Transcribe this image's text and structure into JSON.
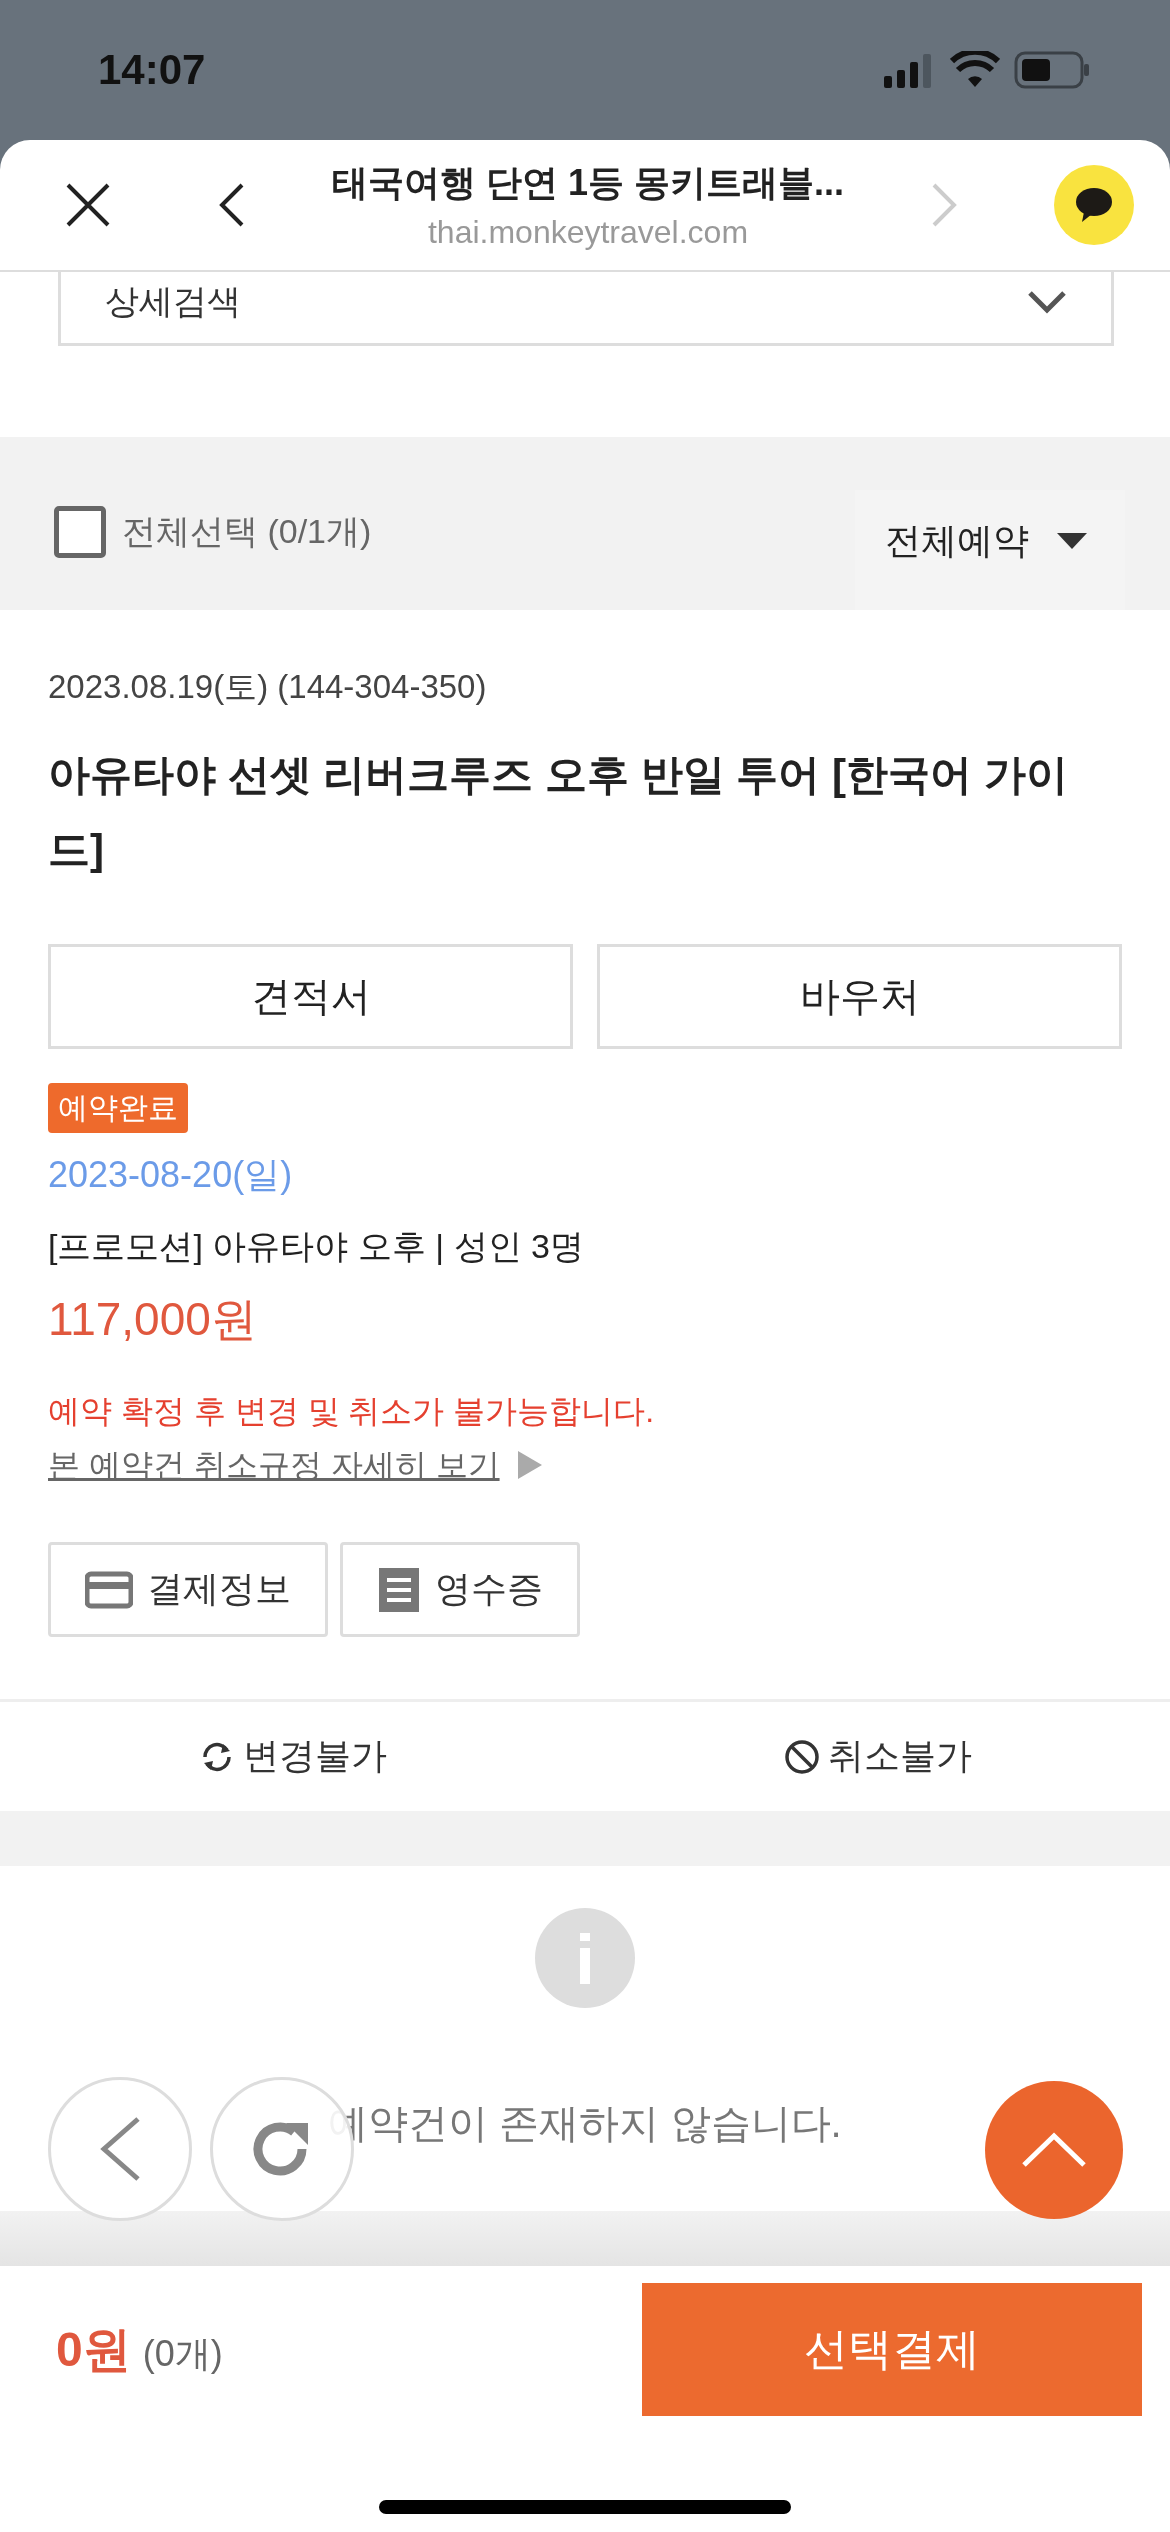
{
  "status_bar": {
    "time": "14:07"
  },
  "browser_header": {
    "title": "태국여행 단연 1등 몽키트래블...",
    "url": "thai.monkeytravel.com"
  },
  "filter": {
    "detail_search": "상세검색"
  },
  "selection_bar": {
    "select_all": {
      "label": "전체선택 (0/1개)",
      "checked": false
    },
    "dropdown": "전체예약"
  },
  "booking": {
    "date_code": "2023.08.19(토) (144-304-350)",
    "title": "아유타야 선셋 리버크루즈 오후 반일 투어 [한국어 가이드]",
    "documents": [
      "견적서",
      "바우처"
    ],
    "status_badge": "예약완료",
    "travel_date": "2023-08-20(일)",
    "description": "[프로모션] 아유타야 오후 | 성인 3명",
    "price": "117,000원",
    "warning": "예약 확정 후 변경 및 취소가 불가능합니다.",
    "policy_link": "본 예약건 취소규정 자세히 보기",
    "info_buttons": [
      {
        "label": "결제정보",
        "kind": "card"
      },
      {
        "label": "영수증",
        "kind": "receipt"
      }
    ],
    "actions": [
      {
        "label": "변경불가",
        "kind": "change"
      },
      {
        "label": "취소불가",
        "kind": "cancel"
      }
    ]
  },
  "empty_state": {
    "message": "예약건이 존재하지 않습니다."
  },
  "bottom_bar": {
    "total": "0원",
    "count": "(0개)",
    "pay_button": "선택결제"
  }
}
